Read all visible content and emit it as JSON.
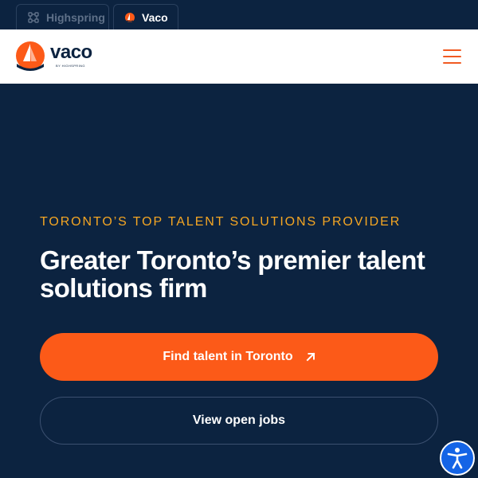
{
  "brand_tabs": [
    {
      "label": "Highspring",
      "icon": "highspring-logo-icon",
      "active": false
    },
    {
      "label": "Vaco",
      "icon": "vaco-logo-icon",
      "active": true
    }
  ],
  "header": {
    "logo_text": "vaco",
    "logo_subtext": "BY HIGHSPRING",
    "menu_icon": "hamburger-menu-icon"
  },
  "hero": {
    "eyebrow": "TORONTO’S TOP TALENT SOLUTIONS PROVIDER",
    "headline": "Greater Toronto’s premier talent solutions firm",
    "primary_button": "Find talent in Toronto",
    "primary_button_icon": "arrow-up-right-icon",
    "secondary_button": "View open jobs"
  },
  "accessibility_widget": {
    "icon": "accessibility-icon"
  },
  "colors": {
    "navy": "#0c2340",
    "orange": "#fc5a18",
    "gold": "#f5a623",
    "blue": "#1464e6",
    "white": "#ffffff"
  }
}
